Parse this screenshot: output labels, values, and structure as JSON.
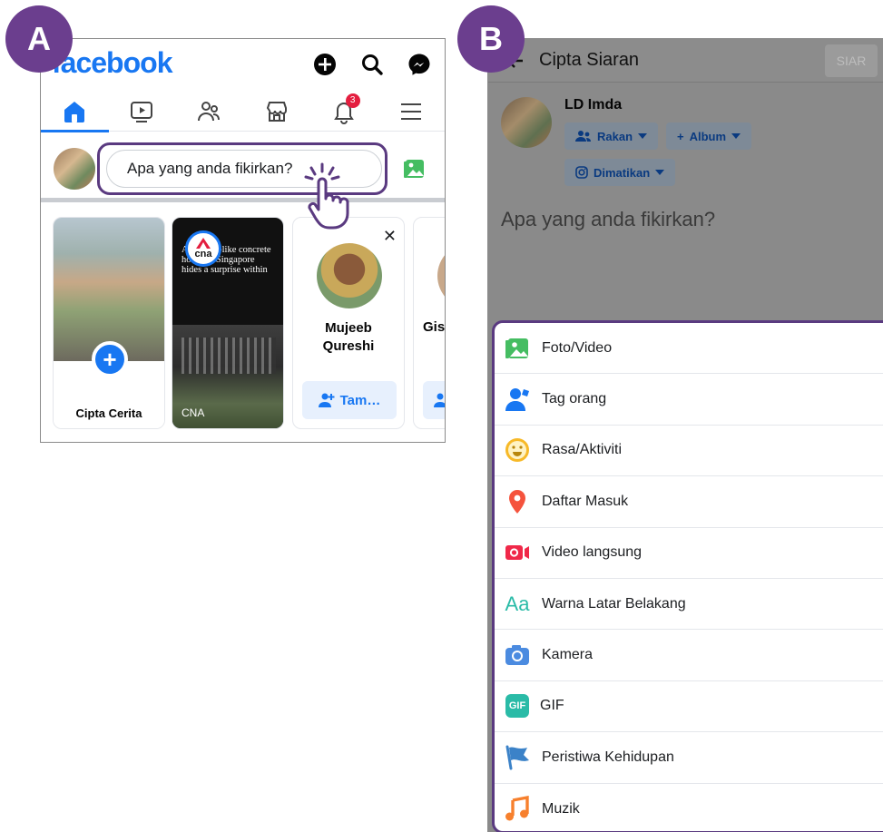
{
  "badges": {
    "a": "A",
    "b": "B"
  },
  "panel_a": {
    "logo": "facebook",
    "notifications_count": "3",
    "composer_placeholder": "Apa yang anda fikirkan?",
    "stories": [
      {
        "label": "Cipta Cerita",
        "action": "+"
      },
      {
        "title": "A fortress-like concrete house in Singapore hides a surprise within",
        "source_logo": "cna",
        "label": "CNA"
      },
      {
        "name": "Mujeeb Qureshi",
        "button": "Tam…",
        "close": "✕"
      },
      {
        "name": "Giss",
        "button": ""
      }
    ]
  },
  "panel_b": {
    "title": "Cipta Siaran",
    "post_button": "SIAR",
    "user_name": "LD Imda",
    "audience": "Rakan",
    "album": "Album",
    "instagram": "Dimatikan",
    "placeholder": "Apa yang anda fikirkan?",
    "menu": [
      {
        "label": "Foto/Video",
        "icon": "photo-icon"
      },
      {
        "label": "Tag orang",
        "icon": "tag-people-icon"
      },
      {
        "label": "Rasa/Aktiviti",
        "icon": "smiley-icon"
      },
      {
        "label": "Daftar Masuk",
        "icon": "location-pin-icon"
      },
      {
        "label": "Video langsung",
        "icon": "live-video-icon"
      },
      {
        "label": "Warna Latar Belakang",
        "icon": "text-color-icon",
        "icon_text": "Aa"
      },
      {
        "label": "Kamera",
        "icon": "camera-icon"
      },
      {
        "label": "GIF",
        "icon": "gif-icon",
        "icon_text": "GIF"
      },
      {
        "label": "Peristiwa Kehidupan",
        "icon": "flag-icon"
      },
      {
        "label": "Muzik",
        "icon": "music-note-icon"
      }
    ]
  },
  "colors": {
    "brand": "#1877f2",
    "highlight": "#5a3a80",
    "badge": "#6b3e8e",
    "alert": "#e41e3f"
  }
}
